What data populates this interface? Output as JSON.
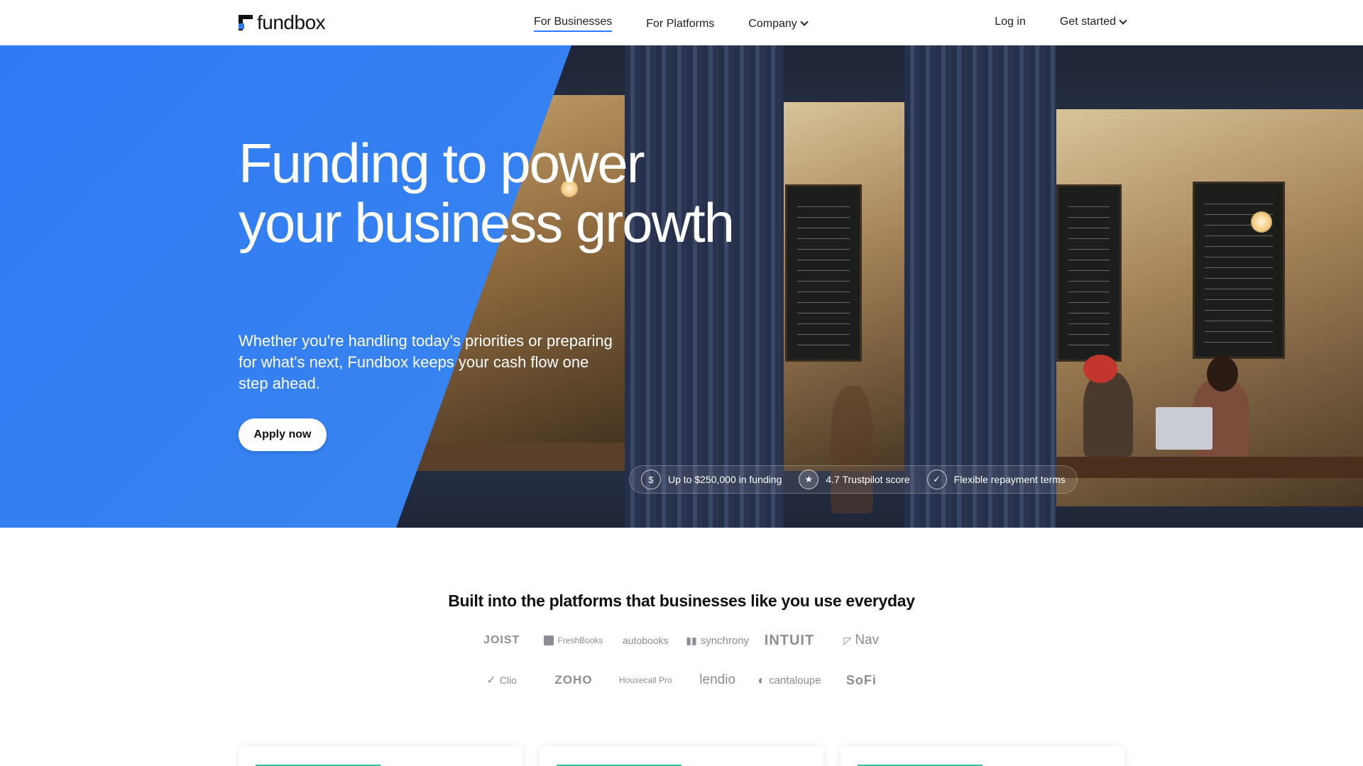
{
  "brand": {
    "name": "fundbox",
    "accent": "#2f7bf5"
  },
  "nav": {
    "links": [
      {
        "label": "For Businesses",
        "active": true
      },
      {
        "label": "For Platforms"
      },
      {
        "label": "Company",
        "dropdown": true
      }
    ],
    "login": "Log in",
    "get_started": "Get started"
  },
  "hero": {
    "title": "Funding to power your business growth",
    "subtitle": "Whether you're handling today's priorities or preparing for what's next, Fundbox keeps your cash flow one step ahead.",
    "cta": "Apply now",
    "badges": [
      {
        "icon": "dollar-icon",
        "text": "Up to $250,000 in funding"
      },
      {
        "icon": "star-icon",
        "text": "4.7 Trustpilot score"
      },
      {
        "icon": "check-icon",
        "text": "Flexible repayment terms"
      }
    ]
  },
  "partners": {
    "title": "Built into the platforms that businesses like you use everyday",
    "logos": [
      "JOIST",
      "FreshBooks",
      "autobooks",
      "synchrony",
      "INTUIT",
      "Nav",
      "Clio",
      "ZOHO",
      "Housecall Pro",
      "lendio",
      "cantaloupe",
      "SoFi"
    ]
  }
}
